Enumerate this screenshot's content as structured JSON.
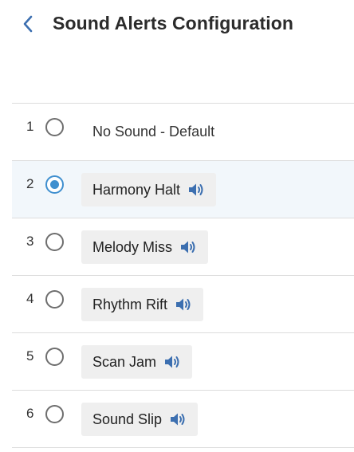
{
  "header": {
    "title": "Sound Alerts Configuration",
    "back_icon": "chevron-left-icon"
  },
  "colors": {
    "accent": "#3f8fcf",
    "selected_row_bg": "#f2f7fb",
    "chip_bg": "#efefef",
    "back_chevron": "#3c6fb0",
    "speaker_icon": "#3c6fb0"
  },
  "options": [
    {
      "number": "1",
      "label": "No Sound - Default",
      "selected": false,
      "has_preview": false
    },
    {
      "number": "2",
      "label": "Harmony Halt",
      "selected": true,
      "has_preview": true,
      "preview_icon": "speaker-icon"
    },
    {
      "number": "3",
      "label": "Melody Miss",
      "selected": false,
      "has_preview": true,
      "preview_icon": "speaker-icon"
    },
    {
      "number": "4",
      "label": "Rhythm Rift",
      "selected": false,
      "has_preview": true,
      "preview_icon": "speaker-icon"
    },
    {
      "number": "5",
      "label": "Scan Jam",
      "selected": false,
      "has_preview": true,
      "preview_icon": "speaker-icon"
    },
    {
      "number": "6",
      "label": "Sound Slip",
      "selected": false,
      "has_preview": true,
      "preview_icon": "speaker-icon"
    }
  ]
}
